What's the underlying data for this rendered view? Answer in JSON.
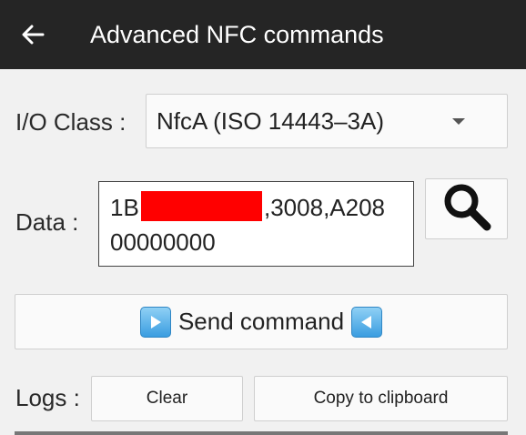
{
  "appbar": {
    "title": "Advanced NFC commands"
  },
  "io_class": {
    "label": "I/O Class :",
    "value": "NfcA (ISO 14443–3A)"
  },
  "data_field": {
    "label": "Data :",
    "prefix": "1B",
    "line1_suffix": ",3008,A208",
    "line2": "00000000"
  },
  "send_button": {
    "label": "Send command"
  },
  "logs": {
    "label": "Logs :",
    "clear_label": "Clear",
    "copy_label": "Copy to clipboard"
  },
  "colors": {
    "appbar_bg": "#252525",
    "redaction": "#ff0000",
    "send_icon": "#3a9de0"
  }
}
